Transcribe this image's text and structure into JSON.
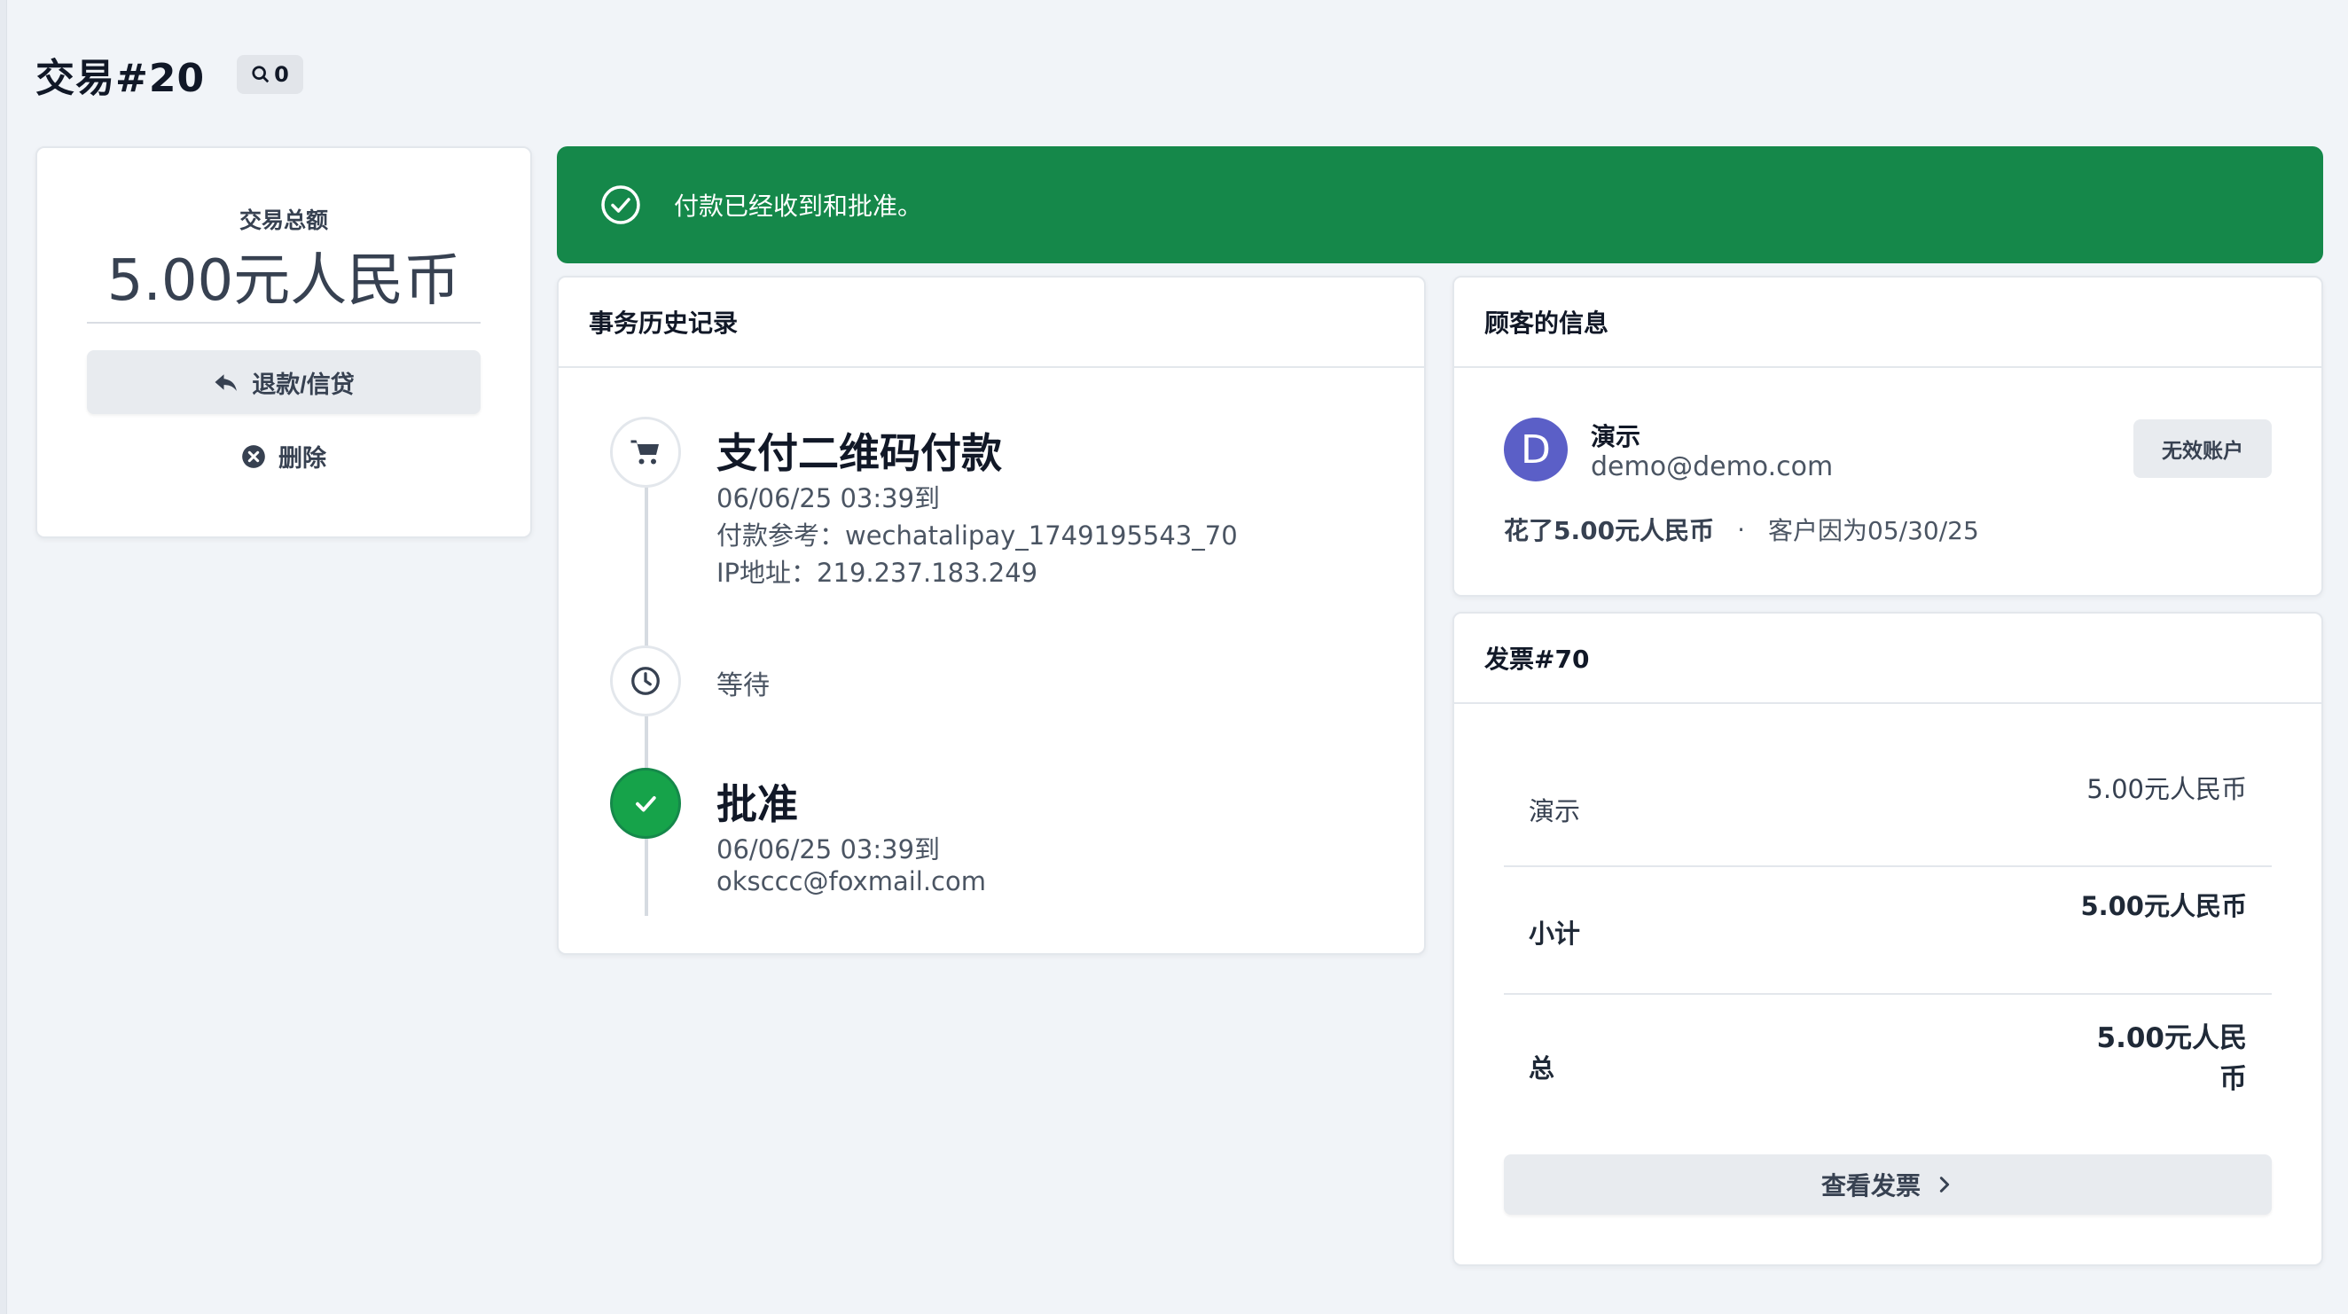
{
  "header": {
    "title": "交易#20",
    "search_count": "0"
  },
  "summary": {
    "label": "交易总额",
    "amount": "5.00元人民币",
    "refund_label": "退款/信贷",
    "delete_label": "删除"
  },
  "banner": {
    "message": "付款已经收到和批准。"
  },
  "history": {
    "title": "事务历史记录",
    "payment": {
      "title": "支付二维码付款",
      "datetime": "06/06/25 03:39到",
      "reference": "付款参考：wechatalipay_1749195543_70",
      "ip": "IP地址：219.237.183.249"
    },
    "waiting_label": "等待",
    "approved": {
      "title": "批准",
      "datetime": "06/06/25 03:39到",
      "email": "oksccc@foxmail.com"
    }
  },
  "customer": {
    "title": "顾客的信息",
    "avatar_letter": "D",
    "name": "演示",
    "email": "demo@demo.com",
    "inactive_label": "无效账户",
    "spent": "花了5.00元人民币",
    "separator": "·",
    "since": "客户因为05/30/25"
  },
  "invoice": {
    "title": "发票#70",
    "rows": [
      {
        "label": "演示",
        "value": "5.00元人民币"
      },
      {
        "label": "小计",
        "value": "5.00元人民币"
      },
      {
        "label": "总",
        "value": "5.00元人民币"
      }
    ],
    "view_label": "查看发票"
  },
  "colors": {
    "success_banner": "#15884a",
    "approved_icon": "#16a34a",
    "avatar": "#5b5fc7",
    "background": "#f1f4f8"
  },
  "icons": [
    "search-icon",
    "reply-icon",
    "close-circle-icon",
    "check-circle-icon",
    "cart-icon",
    "clock-icon",
    "check-icon",
    "chevron-right-icon"
  ]
}
